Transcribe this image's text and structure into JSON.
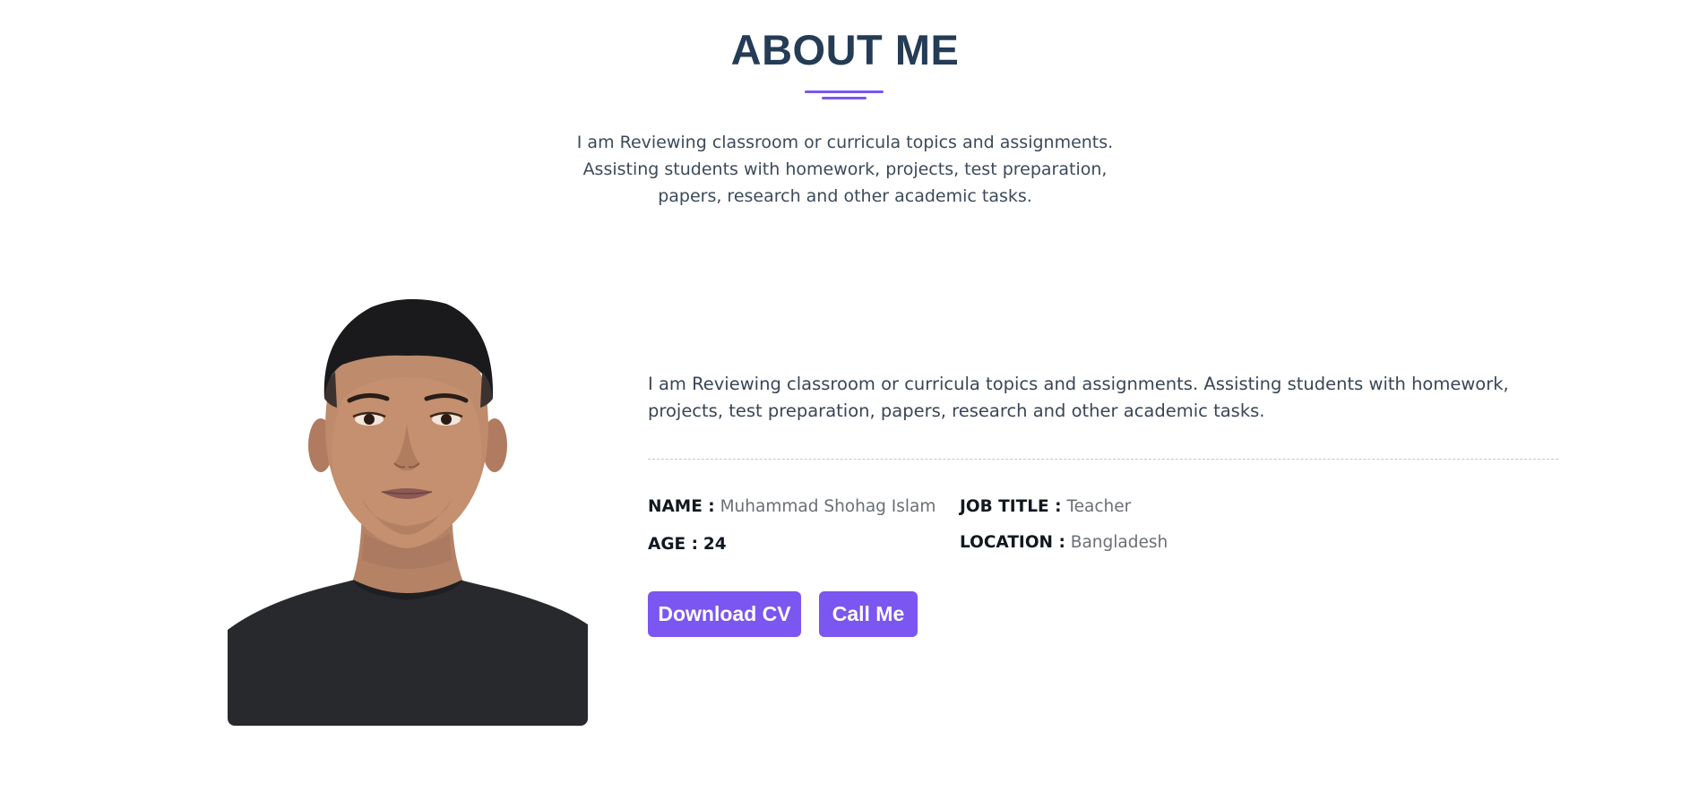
{
  "heading": "ABOUT ME",
  "intro": "I am Reviewing classroom or curricula topics and assignments. Assisting students with homework, projects, test preparation, papers, research and other academic tasks.",
  "bio": "I am Reviewing classroom or curricula topics and assignments. Assisting students with homework, projects, test preparation, papers, research and other academic tasks.",
  "info": {
    "name": {
      "key": "NAME :",
      "value": "Muhammad Shohag Islam"
    },
    "job_title": {
      "key": "JOB TITLE :",
      "value": "Teacher"
    },
    "age": {
      "key": "AGE :",
      "value": "24"
    },
    "location": {
      "key": "LOCATION :",
      "value": "Bangladesh"
    }
  },
  "buttons": {
    "download_cv": "Download CV",
    "call_me": "Call Me"
  },
  "colors": {
    "accent": "#7b56f0",
    "heading": "#253c56"
  },
  "photo": {
    "subject": "portrait-photo"
  }
}
